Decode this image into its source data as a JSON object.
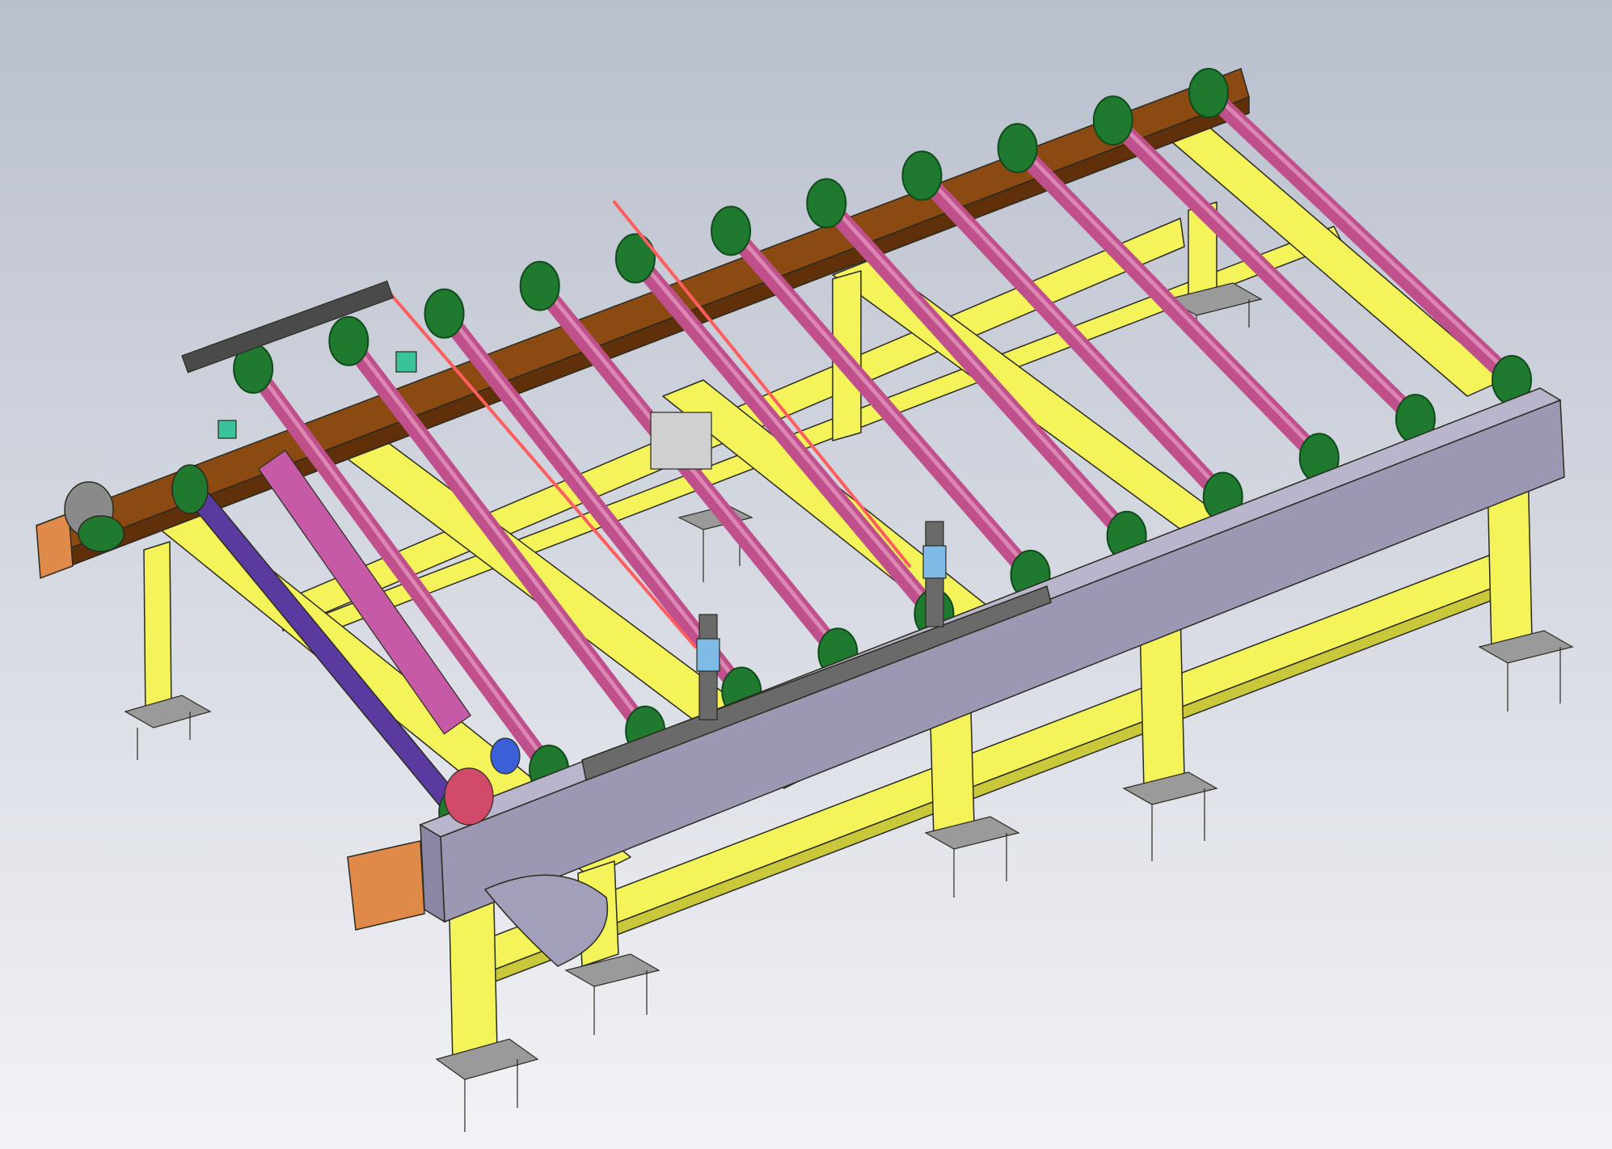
{
  "viewport": {
    "background_top": "#b9bfcd",
    "background_bottom": "#f2f3f6"
  },
  "colors": {
    "frame_yellow": "#f4f45a",
    "frame_yellow_shadow": "#c9c83a",
    "outline": "#2a2a20",
    "rail_brown": "#8b4a12",
    "rail_brown_dark": "#5f300a",
    "roller_pink": "#c0508c",
    "roller_pink_light": "#dc86b4",
    "bearing_green": "#1f7a2f",
    "bearing_green_dark": "#0f4a1a",
    "motor_roller_purple": "#5b3aa0",
    "gray_beam": "#9c98b4",
    "gray_beam_top": "#b8b5cc",
    "foot_plate": "#9a9a9a",
    "red_rod": "#ff5d5d",
    "magenta_part": "#c65aa6",
    "blue_part": "#3a5fd6",
    "cyan_sensor": "#7fbbe6",
    "aluminum_profile": "#6a6a6a",
    "orange_bracket": "#e08a4a"
  },
  "model": {
    "name": "roller-conveyor-assembly",
    "roller_count": 12,
    "leveling_foot_count": 8
  }
}
